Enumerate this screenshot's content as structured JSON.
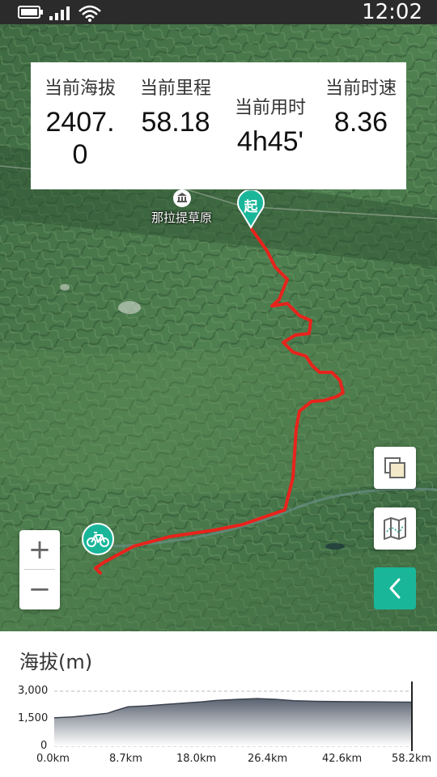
{
  "status_bar": {
    "time": "12:02"
  },
  "stats": [
    {
      "label": "当前海拔",
      "value_line1": "2407.",
      "value_line2": "0"
    },
    {
      "label": "当前里程",
      "value_line1": "58.18",
      "value_line2": ""
    },
    {
      "label": "当前用时",
      "value_line1": "4h45'",
      "value_line2": ""
    },
    {
      "label": "当前时速",
      "value_line1": "8.36",
      "value_line2": ""
    }
  ],
  "map": {
    "poi_label": "那拉提草原",
    "start_marker": "起",
    "zoom_in": "+",
    "zoom_out": "−",
    "route_color": "#e8231c"
  },
  "chart_data": {
    "type": "area",
    "title": "海拔(m)",
    "x_tick_labels": [
      "0.0km",
      "8.7km",
      "18.0km",
      "26.4km",
      "42.6km",
      "58.2km"
    ],
    "y_tick_labels": [
      "3,000",
      "1,500",
      "0"
    ],
    "ylim": [
      0,
      3000
    ],
    "xlim": [
      0,
      58.2
    ],
    "grid": true,
    "series": [
      {
        "x": [
          0,
          3,
          6,
          8.7,
          10,
          12,
          15,
          18,
          21,
          24,
          26.4,
          30,
          33,
          36,
          39,
          42.6,
          47,
          52,
          55,
          58.2
        ],
        "y": [
          1550,
          1600,
          1700,
          1800,
          1950,
          2150,
          2200,
          2280,
          2350,
          2420,
          2500,
          2560,
          2600,
          2560,
          2480,
          2450,
          2430,
          2420,
          2410,
          2407
        ]
      }
    ]
  }
}
